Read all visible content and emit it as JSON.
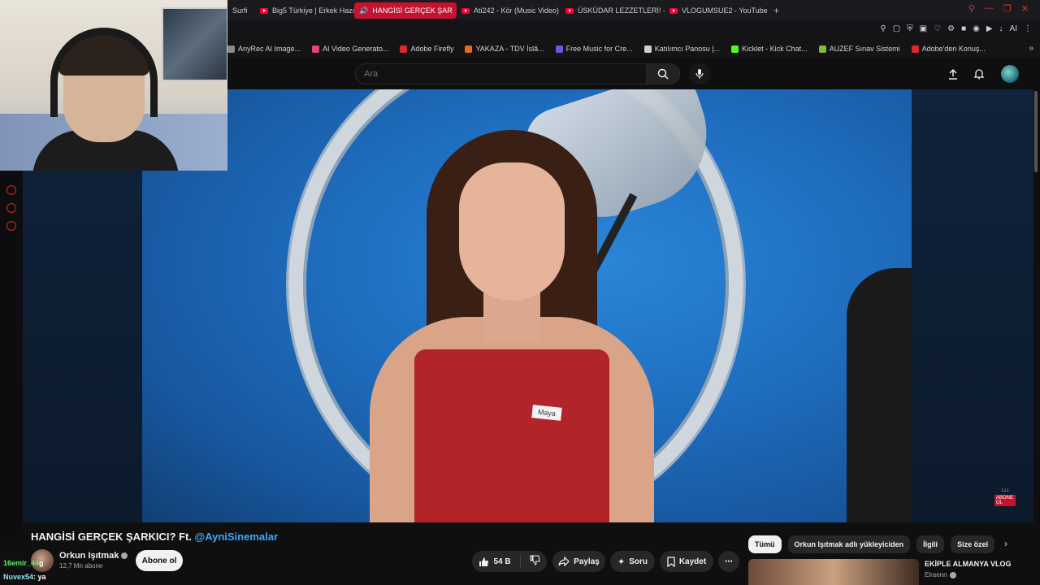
{
  "browser": {
    "tabs": [
      {
        "label": "Surfi",
        "active": false
      },
      {
        "label": "Big5 Türkiye | Erkek Hazır",
        "active": false
      },
      {
        "label": "HANGİSİ GERÇEK ŞAR",
        "active": true
      },
      {
        "label": "Ati242 - Kör (Music Video)",
        "active": false
      },
      {
        "label": "ÜSKÜDAR LEZZETLERİ! - Y",
        "active": false
      },
      {
        "label": "VLOGUMSUE2 - YouTube",
        "active": false
      }
    ],
    "new_tab": "+",
    "ext_ai": "AI",
    "bookmarks": [
      {
        "label": "AnyRec AI Image...",
        "color": "#8a8a8a"
      },
      {
        "label": "AI Video Generato...",
        "color": "#e0457b"
      },
      {
        "label": "Adobe Firefly",
        "color": "#e3262a"
      },
      {
        "label": "YAKAZA - TDV İslâ...",
        "color": "#e86a1e"
      },
      {
        "label": "Free Music for Cre...",
        "color": "#6a5bd6"
      },
      {
        "label": "Katılımcı Panosu |...",
        "color": "#cfcfcf"
      },
      {
        "label": "Kicklet - Kick Chat...",
        "color": "#53fc18"
      },
      {
        "label": "AUZEF Sınav Sistemi",
        "color": "#7dbb3a"
      },
      {
        "label": "Adobe'den Konuş...",
        "color": "#e3262a"
      }
    ]
  },
  "youtube": {
    "search_placeholder": "Ara",
    "colors": {
      "accent": "#ff0033",
      "link": "#3ea6ff"
    }
  },
  "video": {
    "title_main": "HANGİSİ GERÇEK ŞARKICI? Ft. ",
    "title_tag": "@AyniSinemalar",
    "name_tag": "Maya",
    "corner_badge": "ABONE OL"
  },
  "channel": {
    "name": "Orkun Işıtmak",
    "subs": "12,7 Mn abone",
    "subscribe_label": "Abone ol"
  },
  "actions": {
    "likes": "54 B",
    "share": "Paylaş",
    "ask": "Soru",
    "save": "Kaydet"
  },
  "chips": [
    "Tümü",
    "Orkun Işıtmak adlı yükleyiciden",
    "İlgili",
    "Size özel"
  ],
  "recommendation": {
    "title": "EKİPLE ALMANYA VLOG",
    "channel": "Elraenn"
  },
  "chat": [
    {
      "user": "16emir_44",
      "message": "g"
    },
    {
      "user": "Nuvex54",
      "message": ": ya"
    }
  ]
}
